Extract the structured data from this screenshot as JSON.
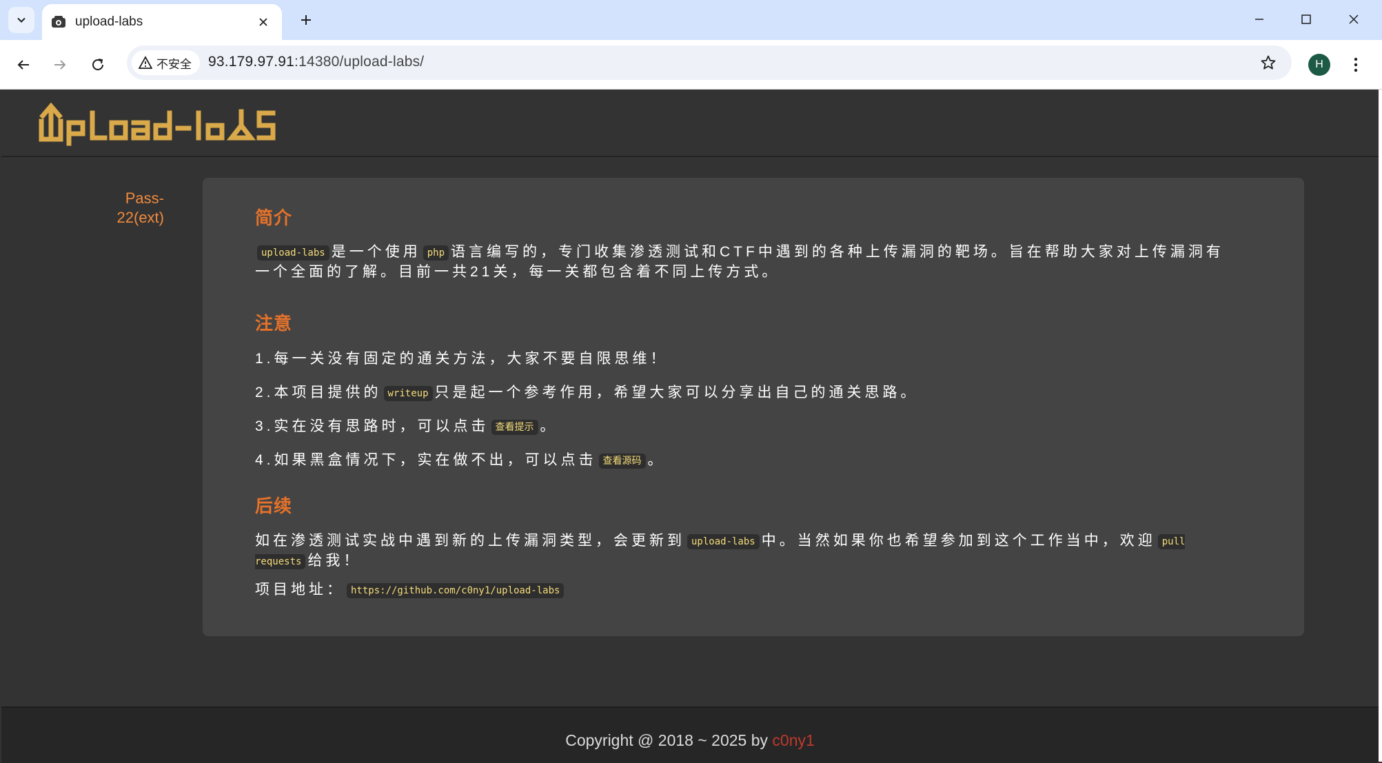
{
  "browser": {
    "tab_title": "upload-labs",
    "security_label": "不安全",
    "url_host": "93.179.97.91",
    "url_rest": ":14380/upload-labs/",
    "profile_initial": "H",
    "icons": [
      "tab-search-icon",
      "favicon-icon",
      "close-icon",
      "plus-icon",
      "minimize-icon",
      "maximize-icon",
      "window-close-icon",
      "back-arrow-icon",
      "forward-arrow-icon",
      "reload-icon",
      "warning-icon",
      "star-icon",
      "more-vert-icon"
    ]
  },
  "header": {
    "logo_text": "upload-labs"
  },
  "sidebar": {
    "pass_link": "Pass-\n22(ext)"
  },
  "intro": {
    "title": "简介",
    "code1": "upload-labs",
    "t1": "是一个使用",
    "code2": "php",
    "t2": "语言编写的，专门收集渗透测试和CTF中遇到的各种上传漏洞的靶场。旨在帮助大家对上传漏洞有一个全面的了解。目前一共21关，每一关都包含着不同上传方式。"
  },
  "notice": {
    "title": "注意",
    "item1": "1.每一关没有固定的通关方法，大家不要自限思维！",
    "item2_a": "2.本项目提供的",
    "item2_code": "writeup",
    "item2_b": "只是起一个参考作用，希望大家可以分享出自己的通关思路。",
    "item3_a": "3.实在没有思路时，可以点击",
    "item3_code": "查看提示",
    "item3_b": "。",
    "item4_a": "4.如果黑盒情况下，实在做不出，可以点击",
    "item4_code": "查看源码",
    "item4_b": "。"
  },
  "followup": {
    "title": "后续",
    "p_a": "如在渗透测试实战中遇到新的上传漏洞类型，会更新到",
    "p_code": "upload-labs",
    "p_b": "中。当然如果你也希望参加到这个工作当中，欢迎",
    "p_code2": "pull requests",
    "p_c": "给我！",
    "addr_label": "项目地址：",
    "addr_code": "https://github.com/c0ny1/upload-labs"
  },
  "footer": {
    "text": "Copyright @ 2018 ~ 2025 by ",
    "author": "c0ny1"
  },
  "colors": {
    "accent_orange": "#e5722a",
    "link_orange": "#f08a3c",
    "code_yellow": "#f5dc7a",
    "author_red": "#c0392b",
    "logo_gold": "#d9a94a"
  }
}
